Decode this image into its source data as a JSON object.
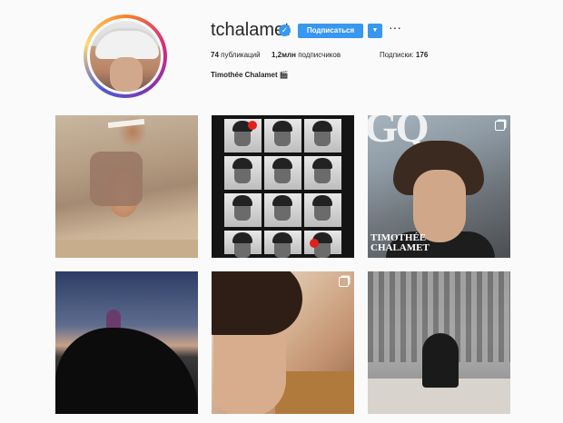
{
  "profile": {
    "username": "tchalamet",
    "verified_icon": "verified-badge-icon",
    "follow_label": "Подписаться",
    "dropdown_icon": "chevron-down-icon",
    "more_icon": "ellipsis-icon",
    "more_glyph": "···",
    "full_name": "Timothée Chalamet 🎬"
  },
  "stats": {
    "posts": {
      "value": "74",
      "label": "публикаций"
    },
    "followers": {
      "value": "1,2млн",
      "label": "подписчиков"
    },
    "following": {
      "label": "Подписки:",
      "value": "176"
    }
  },
  "posts": [
    {
      "id": "post-1",
      "multi": false
    },
    {
      "id": "post-2",
      "multi": false
    },
    {
      "id": "post-3",
      "multi": true,
      "cover_text_1": "TIMOTHÉE",
      "cover_text_2": "CHALAMET"
    },
    {
      "id": "post-4",
      "multi": false
    },
    {
      "id": "post-5",
      "multi": true
    },
    {
      "id": "post-6",
      "multi": false
    }
  ],
  "colors": {
    "accent": "#3897f0",
    "background": "#fafafa",
    "text": "#262626"
  }
}
